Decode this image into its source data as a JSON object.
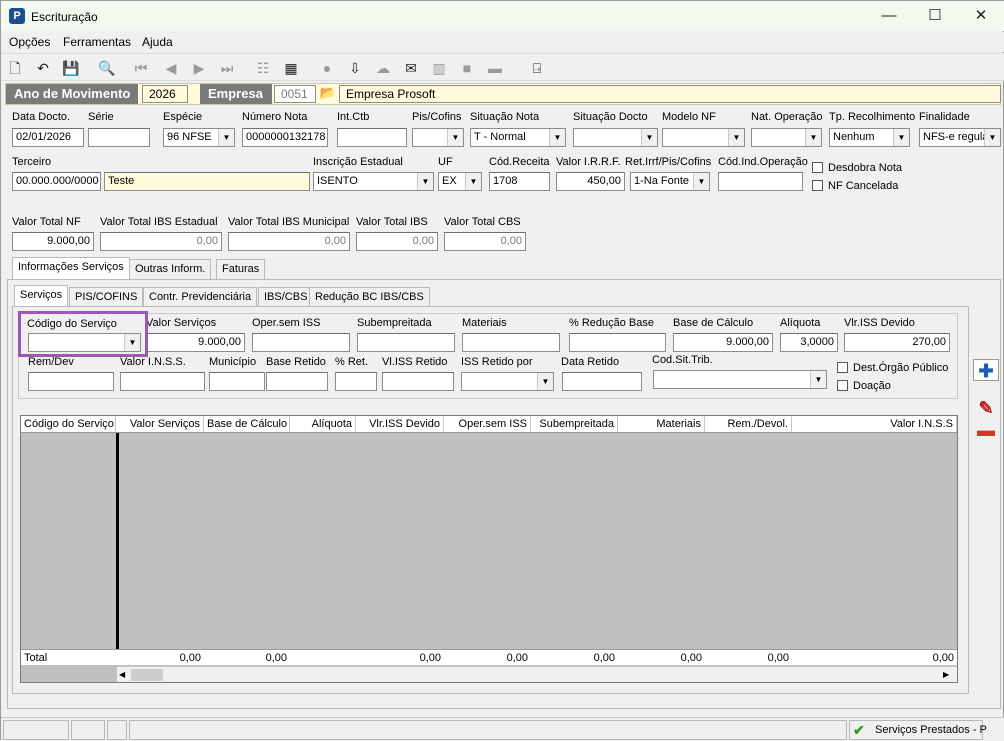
{
  "window": {
    "title": "Escrituração",
    "app_icon": "P",
    "minimize": "—",
    "maximize": "☐",
    "close": "✕"
  },
  "menu": [
    "Opções",
    "Ferramentas",
    "Ajuda"
  ],
  "header": {
    "ano_label": "Ano de Movimento",
    "ano_value": "2026",
    "empresa_label": "Empresa",
    "empresa_code": "0051",
    "empresa_name": "Empresa Prosoft"
  },
  "fields": {
    "data_docto": {
      "label": "Data Docto.",
      "value": "02/01/2026"
    },
    "serie": {
      "label": "Série",
      "value": ""
    },
    "especie": {
      "label": "Espécie",
      "value": "96 NFSE"
    },
    "numero_nota": {
      "label": "Número Nota",
      "value": "0000000132178"
    },
    "int_ctb": {
      "label": "Int.Ctb",
      "value": ""
    },
    "pis_cofins": {
      "label": "Pis/Cofins",
      "value": ""
    },
    "situacao_nota": {
      "label": "Situação Nota",
      "value": "T - Normal"
    },
    "situacao_docto": {
      "label": "Situação Docto",
      "value": ""
    },
    "modelo_nf": {
      "label": "Modelo NF",
      "value": ""
    },
    "nat_operacao": {
      "label": "Nat. Operação",
      "value": ""
    },
    "tp_recolhimento": {
      "label": "Tp. Recolhimento",
      "value": "Nenhum"
    },
    "finalidade": {
      "label": "Finalidade",
      "value": "NFS-e regula"
    },
    "terceiro": {
      "label": "Terceiro",
      "code": "00.000.000/0000",
      "name": "Teste"
    },
    "inscricao_estadual": {
      "label": "Inscrição Estadual",
      "value": "ISENTO"
    },
    "uf": {
      "label": "UF",
      "value": "EX"
    },
    "cod_receita": {
      "label": "Cód.Receita",
      "value": "1708"
    },
    "valor_irrf": {
      "label": "Valor I.R.R.F.",
      "value": "450,00"
    },
    "ret_irrf": {
      "label": "Ret.Irrf/Pis/Cofins",
      "value": "1-Na Fonte"
    },
    "cod_ind_operacao": {
      "label": "Cód.Ind.Operação",
      "value": ""
    },
    "desdobra_nota": {
      "label": "Desdobra Nota"
    },
    "nf_cancelada": {
      "label": "NF Cancelada"
    },
    "valor_total_nf": {
      "label": "Valor Total NF",
      "value": "9.000,00"
    },
    "valor_total_ibs_estadual": {
      "label": "Valor Total IBS Estadual",
      "value": "0,00"
    },
    "valor_total_ibs_municipal": {
      "label": "Valor Total IBS Municipal",
      "value": "0,00"
    },
    "valor_total_ibs": {
      "label": "Valor Total IBS",
      "value": "0,00"
    },
    "valor_total_cbs": {
      "label": "Valor Total CBS",
      "value": "0,00"
    }
  },
  "tabs": [
    "Informações Serviços",
    "Outras Inform.",
    "Faturas"
  ],
  "subtabs": [
    "Serviços",
    "PIS/COFINS",
    "Contr. Previdenciária",
    "IBS/CBS",
    "Redução BC IBS/CBS"
  ],
  "servico": {
    "codigo": {
      "label": "Código do Serviço",
      "value": ""
    },
    "valor_servicos": {
      "label": "Valor Serviços",
      "value": "9.000,00"
    },
    "oper_sem_iss": {
      "label": "Oper.sem ISS",
      "value": ""
    },
    "subempreitada": {
      "label": "Subempreitada",
      "value": ""
    },
    "materiais": {
      "label": "Materiais",
      "value": ""
    },
    "reducao_base": {
      "label": "% Redução Base",
      "value": ""
    },
    "base_calculo": {
      "label": "Base de Cálculo",
      "value": "9.000,00"
    },
    "aliquota": {
      "label": "Alíquota",
      "value": "3,0000"
    },
    "vlr_iss_devido": {
      "label": "Vlr.ISS Devido",
      "value": "270,00"
    },
    "rem_dev": {
      "label": "Rem/Dev",
      "value": ""
    },
    "valor_inss": {
      "label": "Valor I.N.S.S.",
      "value": ""
    },
    "municipio": {
      "label": "Município",
      "value": ""
    },
    "base_retido": {
      "label": "Base Retido",
      "value": ""
    },
    "perc_ret": {
      "label": "% Ret.",
      "value": ""
    },
    "vl_iss_retido": {
      "label": "Vl.ISS Retido",
      "value": ""
    },
    "iss_retido_por": {
      "label": "ISS Retido por",
      "value": ""
    },
    "data_retido": {
      "label": "Data Retido",
      "value": ""
    },
    "cod_sit_trib": {
      "label": "Cod.Sit.Trib.",
      "value": ""
    },
    "dest_orgao_publico": {
      "label": "Dest.Órgão Público"
    },
    "doacao": {
      "label": "Doação"
    }
  },
  "grid": {
    "columns": [
      "Código do Serviço",
      "Valor Serviços",
      "Base de Cálculo",
      "Alíquota",
      "Vlr.ISS Devido",
      "Oper.sem ISS",
      "Subempreitada",
      "Materiais",
      "Rem./Devol.",
      "Valor I.N.S.S"
    ],
    "total_label": "Total",
    "totals": [
      "0,00",
      "0,00",
      "0,00",
      "0,00",
      "0,00",
      "0,00",
      "0,00",
      "0,00"
    ]
  },
  "status": {
    "text": "Serviços Prestados - P"
  },
  "colors": {
    "highlight": "#9b59b6",
    "header_bg": "#fffbdc",
    "grid_bg": "#c0c0c0"
  }
}
